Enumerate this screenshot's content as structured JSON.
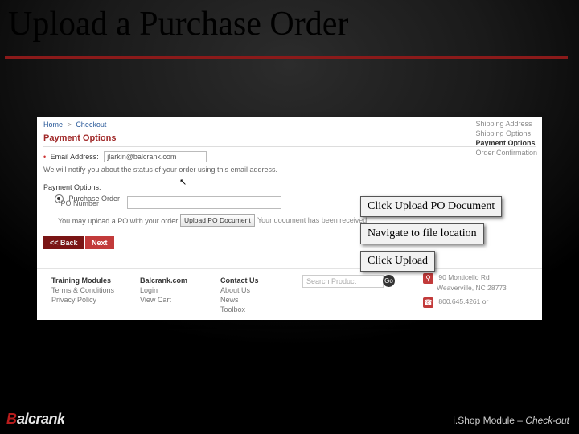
{
  "slide": {
    "title": "Upload a Purchase Order",
    "footer_module": "i.Shop Module – ",
    "footer_page_italic": "Check-out",
    "brand_red": "B",
    "brand_rest": "alcrank"
  },
  "callouts": {
    "step1": "Click Upload PO Document",
    "step2": "Navigate to file location",
    "step3": "Click Upload"
  },
  "breadcrumb": {
    "home": "Home",
    "sep": ">",
    "current": "Checkout"
  },
  "steps_sidebar": {
    "s1": "Shipping Address",
    "s2": "Shipping Options",
    "s3": "Payment Options",
    "s4": "Order Confirmation"
  },
  "payment": {
    "header": "Payment Options",
    "email_label": "Email Address:",
    "email_value": "jlarkin@balcrank.com",
    "email_note": "We will notify you about the status of your order using this email address.",
    "options_label": "Payment Options:",
    "po_label": "Purchase Order",
    "po_number_label": "*PO Number",
    "upload_note": "You may upload a PO with your order:",
    "upload_btn": "Upload PO Document",
    "received_msg": "Your document has been received.",
    "back": "<< Back",
    "next": "Next"
  },
  "footer": {
    "col1a": "Training Modules",
    "col1b": "Terms & Conditions",
    "col1c": "Privacy Policy",
    "col2h": "Balcrank.com",
    "col2a": "Login",
    "col2b": "View Cart",
    "col3h": "Contact Us",
    "col3a": "About Us",
    "col3b": "News",
    "col3c": "Toolbox",
    "search_placeholder": "Search Product",
    "go": "Go",
    "addr1": "90 Monticello Rd",
    "addr2": "Weaverville, NC 28773",
    "phone": "800.645.4261 or",
    "icon_map": "⚲",
    "icon_phone": "☎"
  }
}
